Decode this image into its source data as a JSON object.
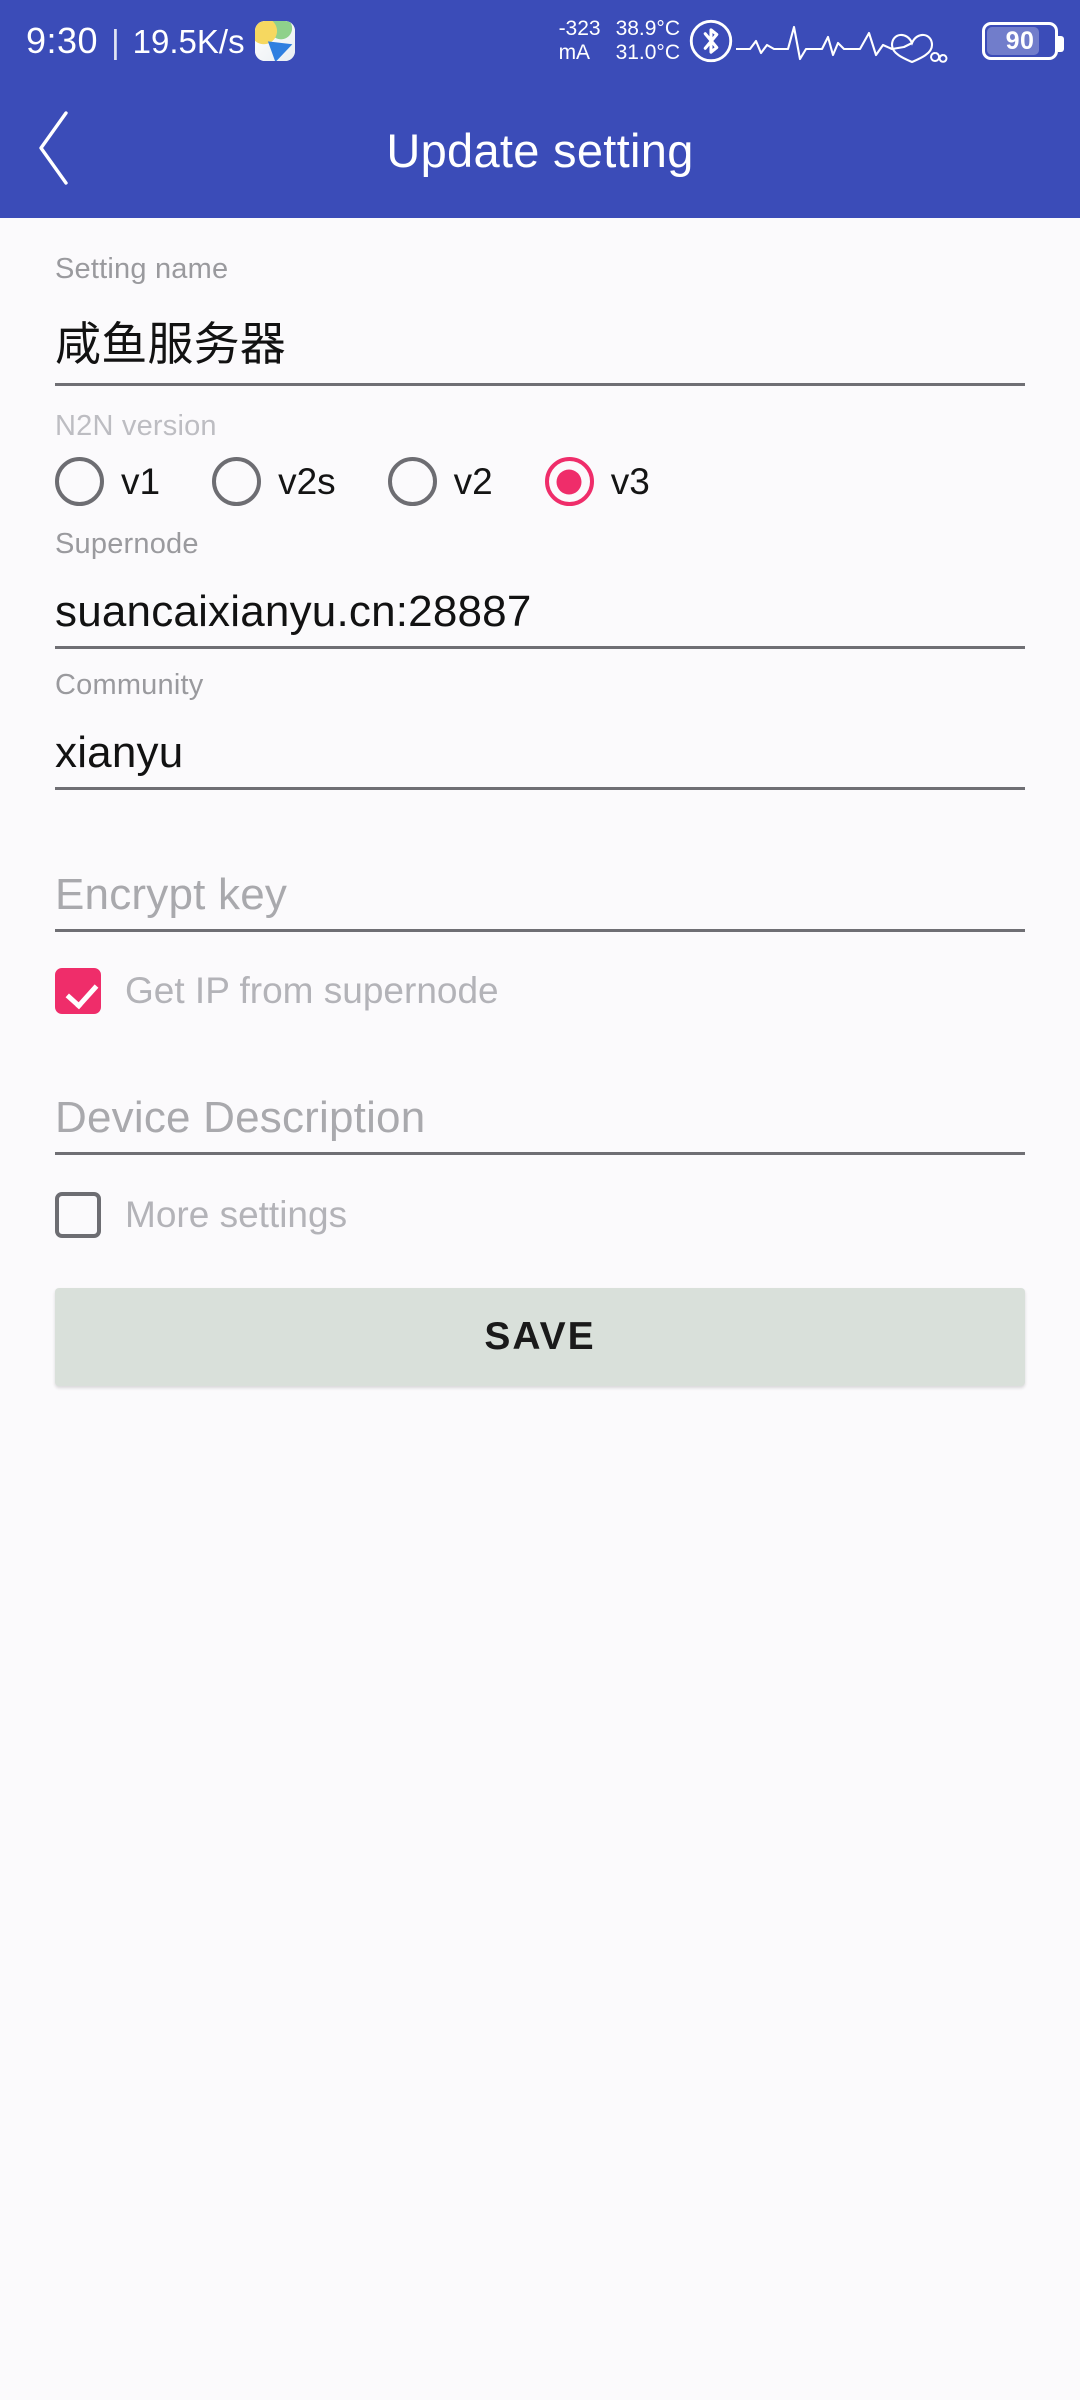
{
  "status_bar": {
    "time": "9:30",
    "separator": "|",
    "network_speed": "19.5K/s",
    "app_icon": "map-navigation-icon",
    "current_draw": "-323",
    "current_unit": "mA",
    "temp_cpu": "38.9°C",
    "temp_battery": "31.0°C",
    "bluetooth_icon": "bluetooth-icon",
    "ecg_icon": "heartbeat-graph-icon",
    "heart_icon": "heart-icon",
    "battery_level": "90",
    "bg_color": "#3b4cb8"
  },
  "appbar": {
    "back_icon": "chevron-left-icon",
    "title": "Update setting",
    "bg_color": "#3b4cb8"
  },
  "form": {
    "setting_name": {
      "label": "Setting name",
      "value": "咸鱼服务器",
      "placeholder": "Setting name"
    },
    "n2n_version": {
      "label": "N2N version",
      "selected": "v3",
      "options": [
        {
          "label": "v1",
          "checked": false
        },
        {
          "label": "v2s",
          "checked": false
        },
        {
          "label": "v2",
          "checked": false
        },
        {
          "label": "v3",
          "checked": true
        }
      ]
    },
    "supernode": {
      "label": "Supernode",
      "value": "suancaixianyu.cn:28887",
      "placeholder": "Supernode"
    },
    "community": {
      "label": "Community",
      "value": "xianyu",
      "placeholder": "Community"
    },
    "encrypt_key": {
      "label": "Encrypt key",
      "value": "",
      "placeholder": "Encrypt key"
    },
    "get_ip_from_supernode": {
      "label": "Get IP from supernode",
      "checked": true
    },
    "device_description": {
      "label": "Device Description",
      "value": "",
      "placeholder": "Device Description"
    },
    "more_settings": {
      "label": "More settings",
      "checked": false
    },
    "save_button": {
      "label": "SAVE"
    }
  },
  "colors": {
    "accent_pink": "#ef2d6a",
    "primary_blue": "#3b4cb8",
    "page_bg": "#fbfafc",
    "save_bg": "#d9e0da",
    "label_gray": "#9a9a9e",
    "underline_gray": "#6f6f74"
  }
}
